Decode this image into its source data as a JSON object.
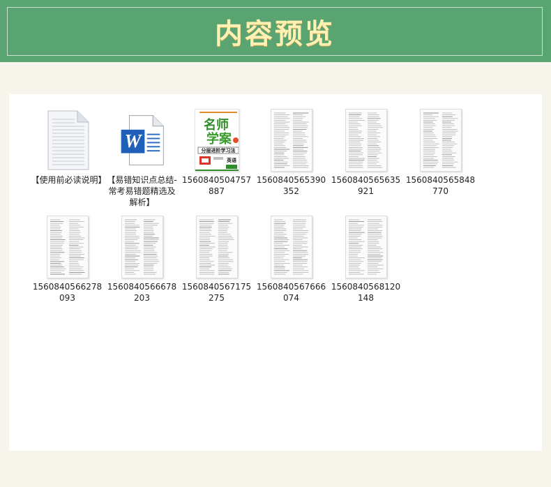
{
  "header": {
    "title": "内容预览"
  },
  "files": [
    {
      "name": "【使用前必读说明】",
      "icon": "text-document-icon"
    },
    {
      "name": "【易错知识点总结-常考易错题精选及解析】",
      "icon": "word-document-icon"
    },
    {
      "name": "1560840504757887",
      "icon": "book-cover-thumbnail"
    },
    {
      "name": "1560840565390352",
      "icon": "page-thumbnail"
    },
    {
      "name": "1560840565635921",
      "icon": "page-thumbnail"
    },
    {
      "name": "1560840565848770",
      "icon": "page-thumbnail"
    },
    {
      "name": "1560840566278093",
      "icon": "page-thumbnail"
    },
    {
      "name": "1560840566678203",
      "icon": "page-thumbnail"
    },
    {
      "name": "1560840567175275",
      "icon": "page-thumbnail"
    },
    {
      "name": "1560840567666074",
      "icon": "page-thumbnail"
    },
    {
      "name": "1560840568120148",
      "icon": "page-thumbnail"
    }
  ],
  "cover": {
    "title_line1": "名师",
    "title_line2": "学案",
    "subtitle": "分层进阶学习法",
    "tag": "英语"
  },
  "colors": {
    "banner": "#5aa472",
    "title": "#fff1b4",
    "word_blue": "#1e5fb8"
  }
}
